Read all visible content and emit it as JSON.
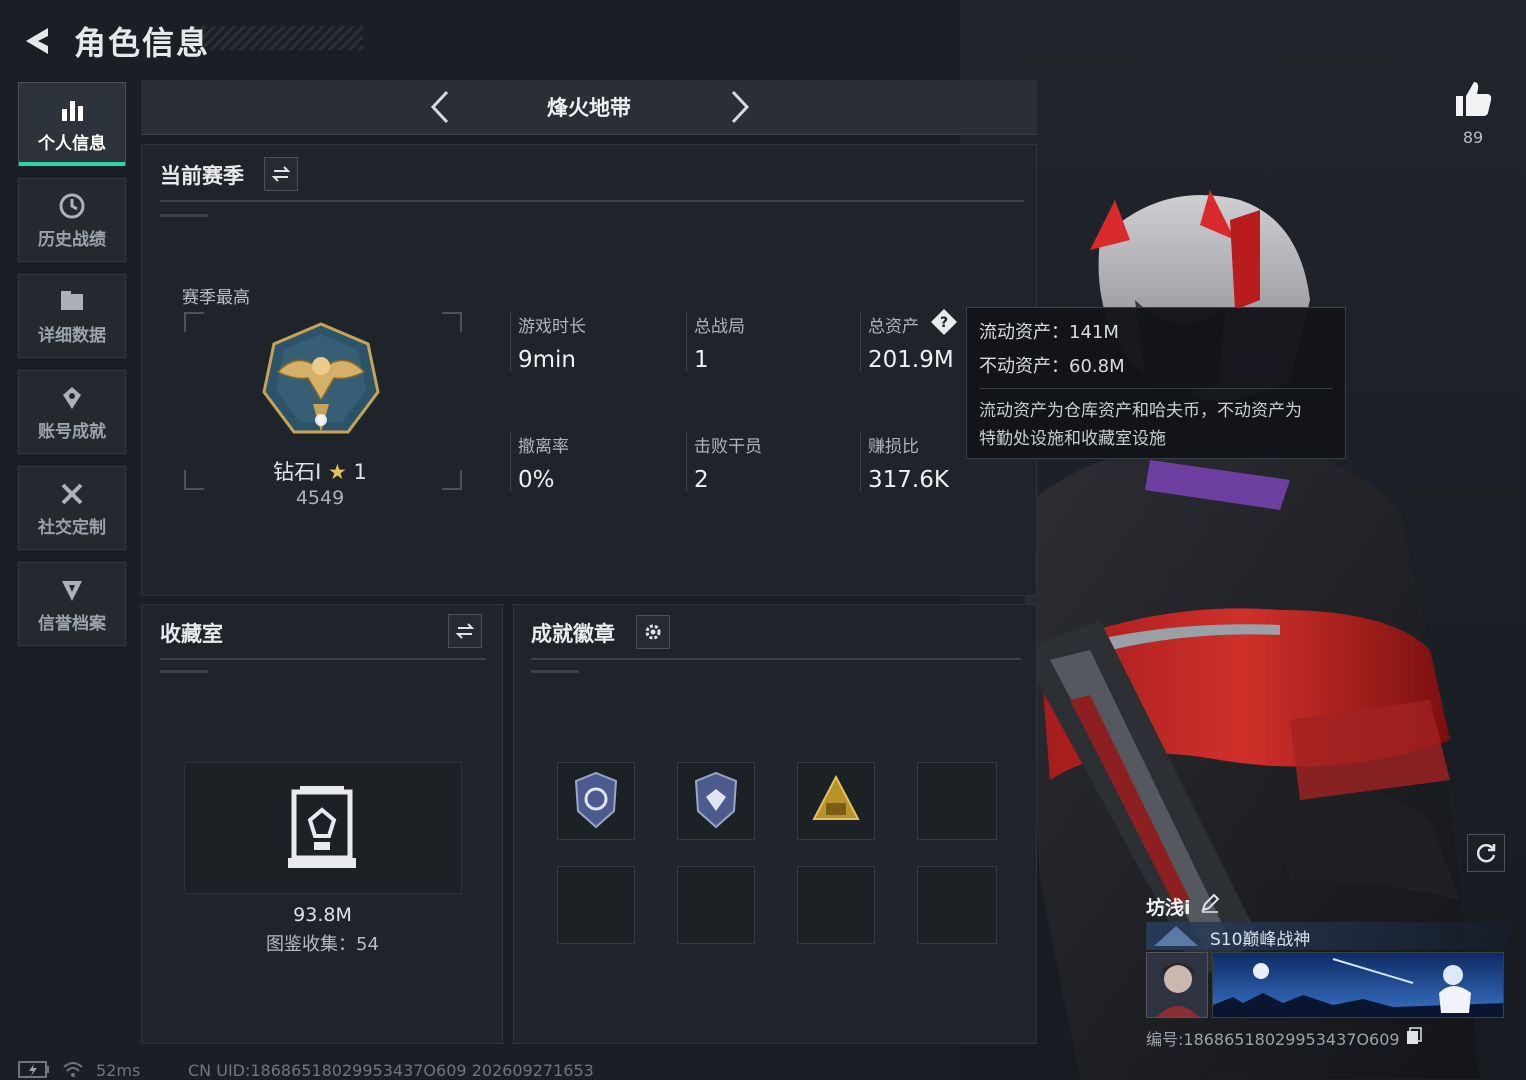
{
  "header": {
    "title": "角色信息"
  },
  "sidebar": {
    "items": [
      {
        "label": "个人信息",
        "icon": "bar-chart-icon",
        "active": true
      },
      {
        "label": "历史战绩",
        "icon": "history-icon",
        "active": false
      },
      {
        "label": "详细数据",
        "icon": "folder-icon",
        "active": false
      },
      {
        "label": "账号成就",
        "icon": "achievement-icon",
        "active": false
      },
      {
        "label": "社交定制",
        "icon": "tools-icon",
        "active": false
      },
      {
        "label": "信誉档案",
        "icon": "credit-shield-icon",
        "active": false
      }
    ]
  },
  "mode": {
    "title": "烽火地带"
  },
  "season": {
    "title": "当前赛季",
    "best_label": "赛季最高",
    "rank_name": "钻石I",
    "rank_stars": "1",
    "rank_score": "4549",
    "stats": [
      {
        "label": "游戏时长",
        "value": "9min"
      },
      {
        "label": "总战局",
        "value": "1"
      },
      {
        "label": "总资产",
        "value": "201.9M"
      },
      {
        "label": "撤离率",
        "value": "0%"
      },
      {
        "label": "击败干员",
        "value": "2"
      },
      {
        "label": "赚损比",
        "value": "317.6K"
      }
    ]
  },
  "tooltip": {
    "liquid": "流动资产：141M",
    "fixed": "不动资产：60.8M",
    "desc_line1": "流动资产为仓库资产和哈夫币，不动资产为",
    "desc_line2": "特勤处设施和收藏室设施"
  },
  "collection": {
    "title": "收藏室",
    "value": "93.8M",
    "label": "图鉴收集：54"
  },
  "badges": {
    "title": "成就徽章"
  },
  "player": {
    "likes": "89",
    "name": "坊浅i",
    "rank_tag": "S10巅峰战神",
    "uid": "编号:18686518029953437O609"
  },
  "footer": {
    "ping": "52ms",
    "uid": "CN UID:18686518029953437O609 202609271653"
  },
  "colors": {
    "accent": "#2fd4a0",
    "background": "#1b1f25",
    "panel": "#1f242a"
  }
}
